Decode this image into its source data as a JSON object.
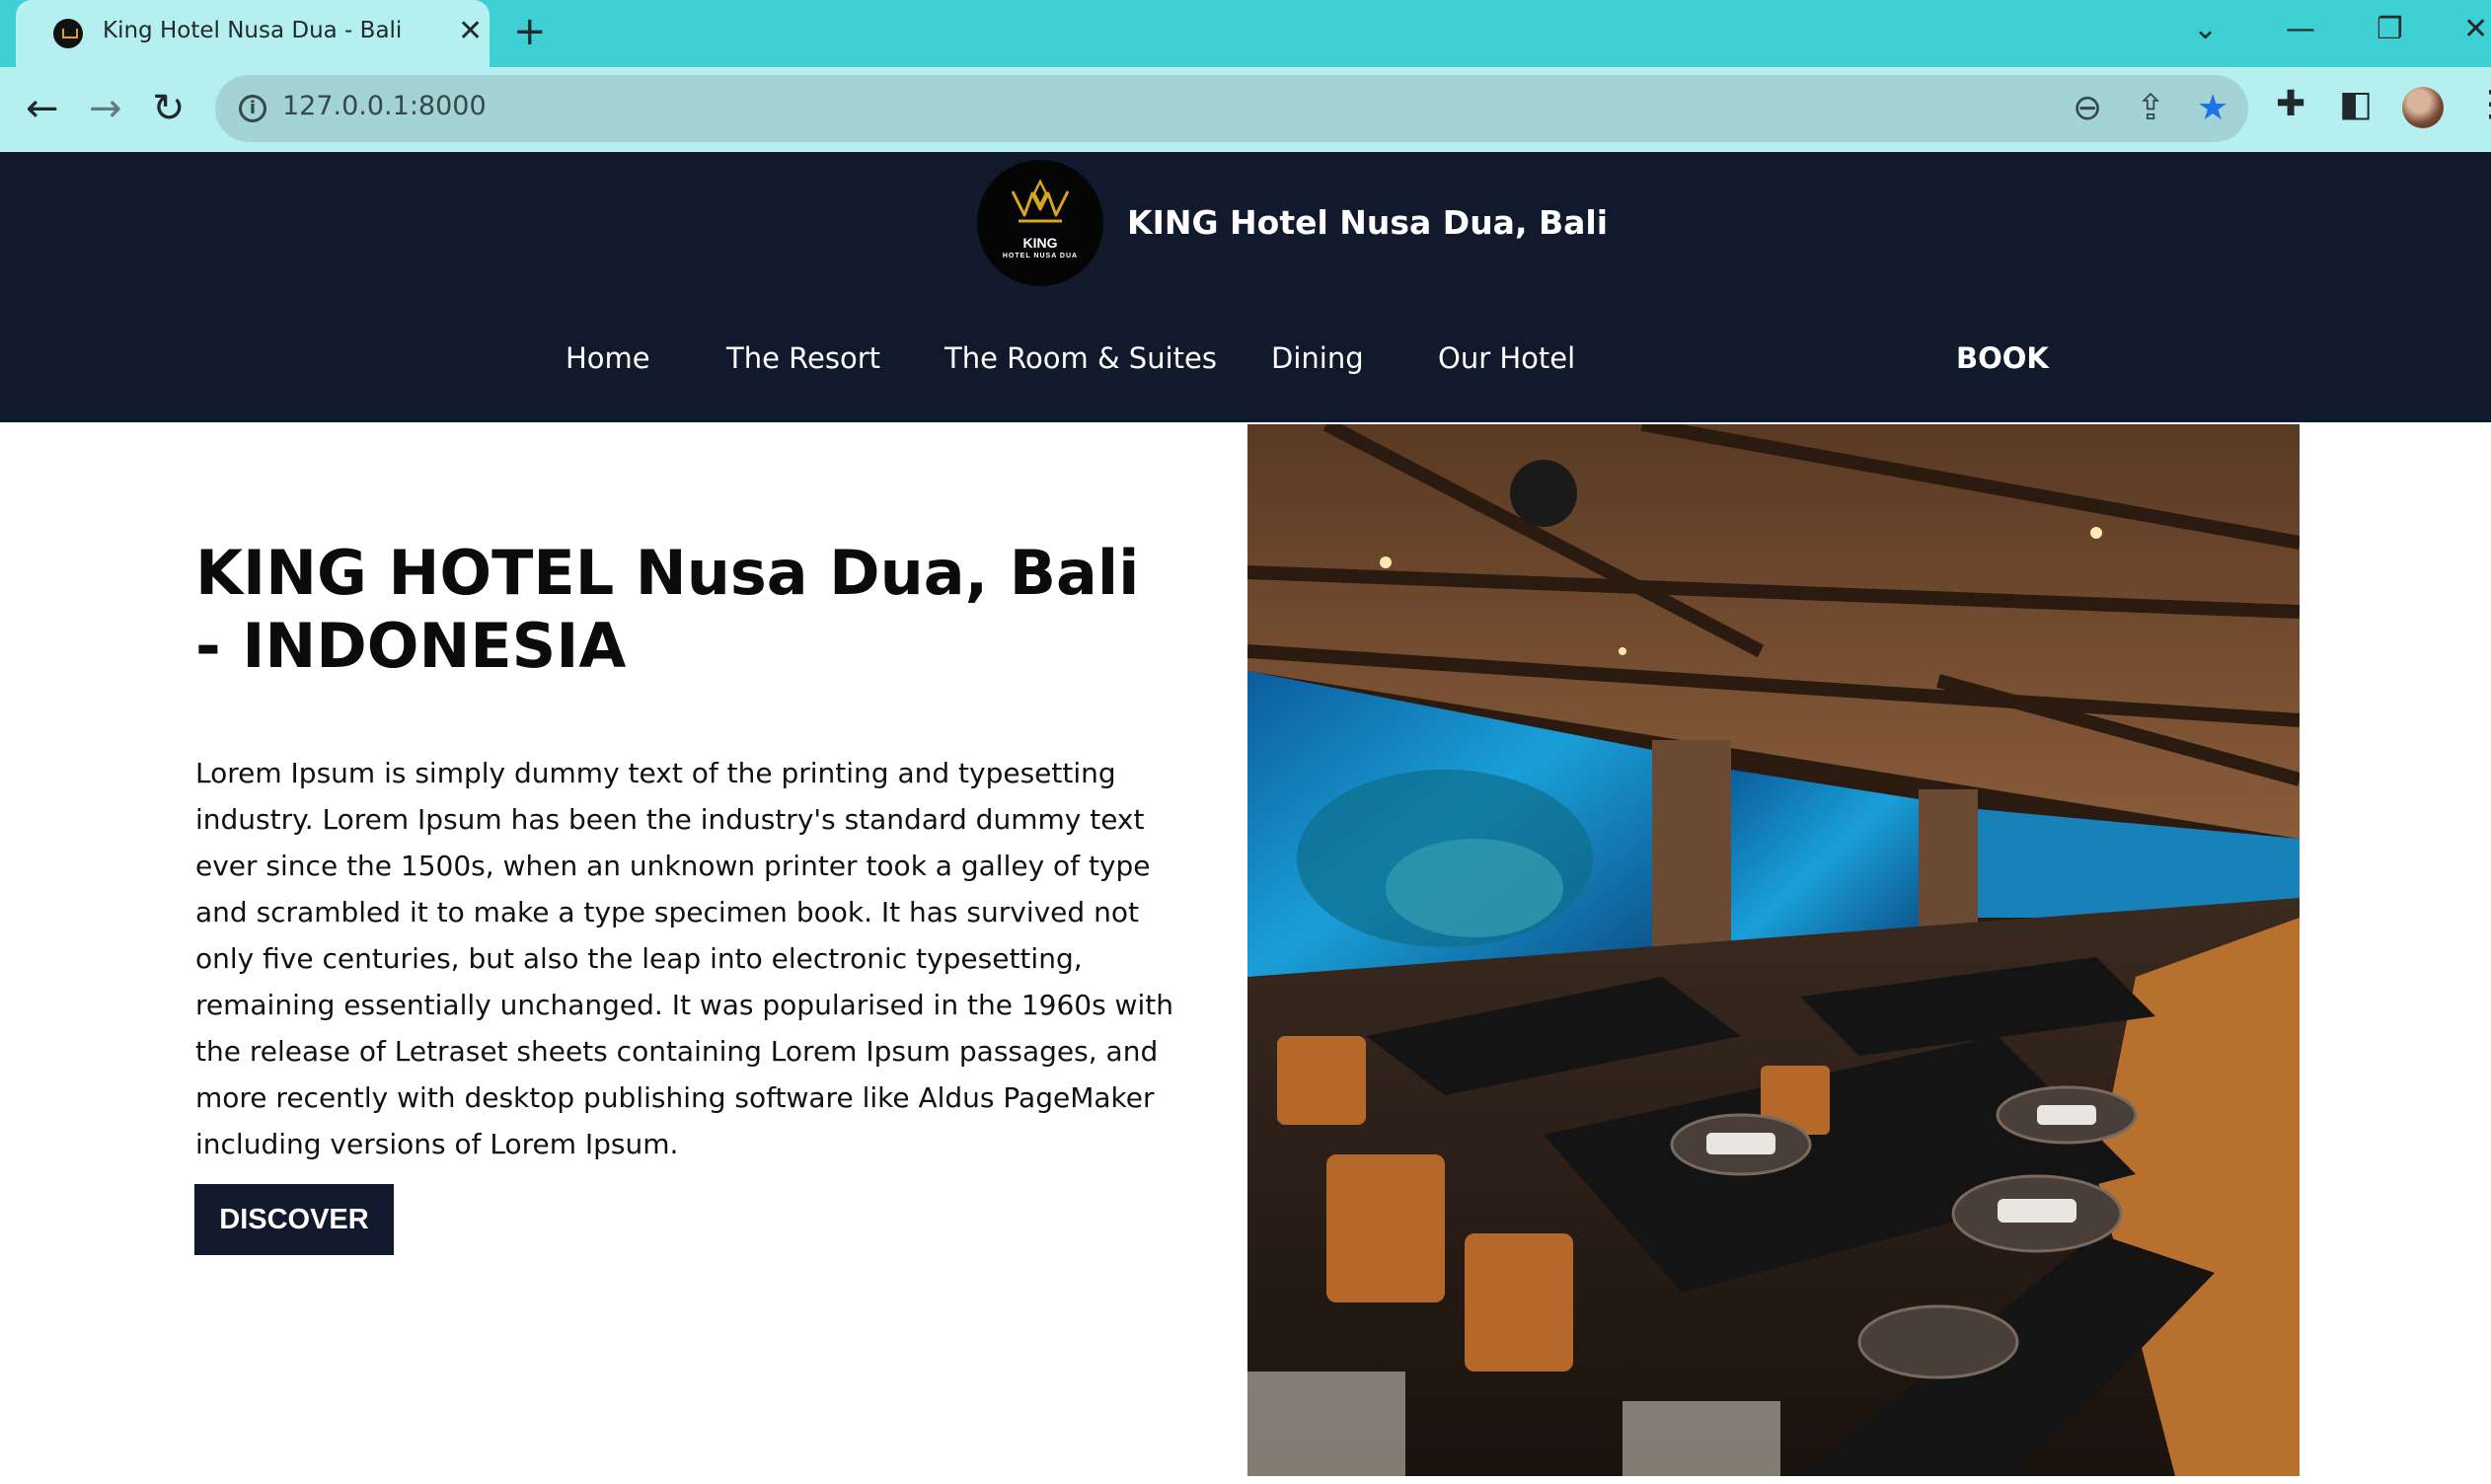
{
  "browser": {
    "tab_title": "King Hotel Nusa Dua - Bali",
    "url": "127.0.0.1:8000"
  },
  "site": {
    "logo_text": "KING",
    "logo_subtext": "HOTEL NUSA DUA",
    "brand_title": "KING Hotel Nusa Dua, Bali",
    "nav": [
      {
        "label": "Home"
      },
      {
        "label": "The Resort"
      },
      {
        "label": "The Room & Suites"
      },
      {
        "label": "Dining"
      },
      {
        "label": "Our Hotel"
      }
    ],
    "book_label": "BOOK"
  },
  "hero": {
    "title": "KING HOTEL Nusa Dua, Bali - INDONESIA",
    "body": "Lorem Ipsum is simply dummy text of the printing and typesetting industry. Lorem Ipsum has been the industry's standard dummy text ever since the 1500s, when an unknown printer took a galley of type and scrambled it to make a type specimen book. It has survived not only five centuries, but also the leap into electronic typesetting, remaining essentially unchanged. It was popularised in the 1960s with the release of Letraset sheets containing Lorem Ipsum passages, and more recently with desktop publishing software like Aldus PageMaker including versions of Lorem Ipsum.",
    "button_label": "DISCOVER"
  },
  "colors": {
    "tabstrip": "#3ed0d2",
    "toolbar": "#b5eff0",
    "header": "#111a2c",
    "accent_gold": "#d9a520"
  },
  "icons": {
    "tab": "crown-favicon",
    "nav": [
      "back-icon",
      "forward-icon",
      "reload-icon"
    ],
    "omnibox": [
      "info-icon",
      "zoom-out-icon",
      "share-icon",
      "bookmark-star-icon"
    ],
    "toolbar": [
      "extensions-icon",
      "side-panel-icon",
      "profile-avatar",
      "menu-icon"
    ]
  }
}
